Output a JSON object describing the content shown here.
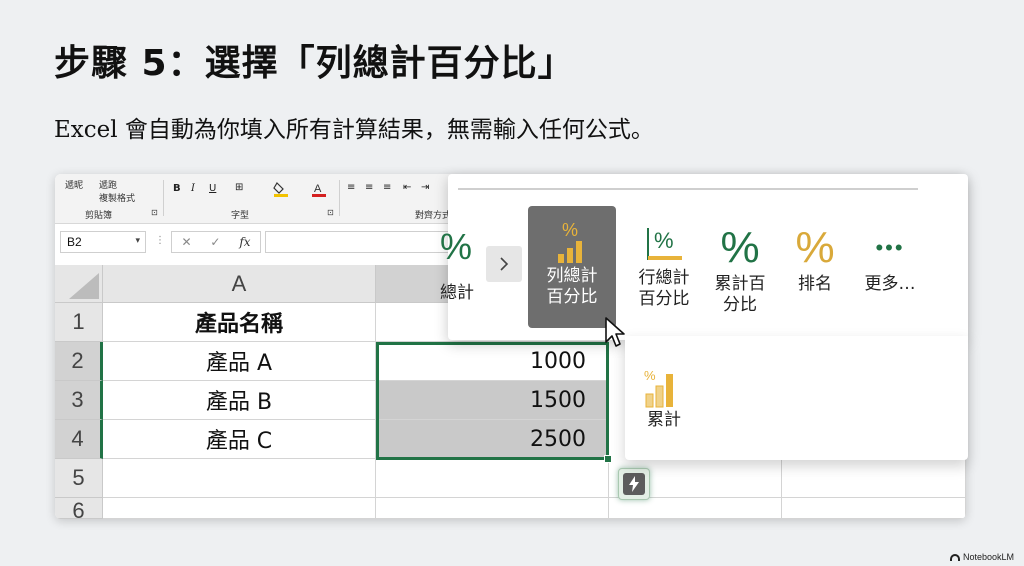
{
  "slide": {
    "title": "步驟 5：選擇「列總計百分比」",
    "subtitle": "Excel 會自動為你填入所有計算結果，無需輸入任何公式。",
    "watermark": "NotebookLM"
  },
  "ribbon": {
    "clipboard_text_a": "遞昵",
    "clipboard_text_b": "複製格式",
    "clipboard_text_c": "遞跑",
    "group_clipboard": "剪貼簿",
    "group_font": "字型",
    "group_alignment": "對齊方式",
    "bold": "B",
    "italic": "I",
    "underline": "U"
  },
  "formula_bar": {
    "name_box": "B2",
    "cancel": "✕",
    "enter": "✓",
    "fx": "fx"
  },
  "grid": {
    "col_a": "A",
    "rows": [
      "1",
      "2",
      "3",
      "4",
      "5",
      "6"
    ],
    "header": "產品名稱",
    "products": [
      "產品 A",
      "產品 B",
      "產品 C"
    ],
    "values": [
      "1000",
      "1500",
      "2500"
    ]
  },
  "quick_analysis": {
    "partial_label": "總計",
    "partial_icon": "%",
    "items": [
      {
        "name": "row-total-percent",
        "line1": "列總計",
        "line2": "百分比",
        "icon": "percent-bar-icon"
      },
      {
        "name": "column-total-percent",
        "line1": "行總計",
        "line2": "百分比",
        "icon": "percent-underline-icon"
      },
      {
        "name": "running-total-percent",
        "line1": "累計百",
        "line2": "分比",
        "icon": "percent-icon"
      },
      {
        "name": "rank",
        "line1": "排名",
        "line2": "",
        "icon": "percent-gold-icon"
      },
      {
        "name": "more",
        "line1": "更多…",
        "line2": "",
        "icon": "more-icon"
      }
    ],
    "running_total": "累計",
    "pct_symbol": "%",
    "more_symbol": "•••"
  },
  "colors": {
    "excel_green": "#217346",
    "gold": "#e8b33a",
    "selected_tile": "#6e6e6e"
  }
}
